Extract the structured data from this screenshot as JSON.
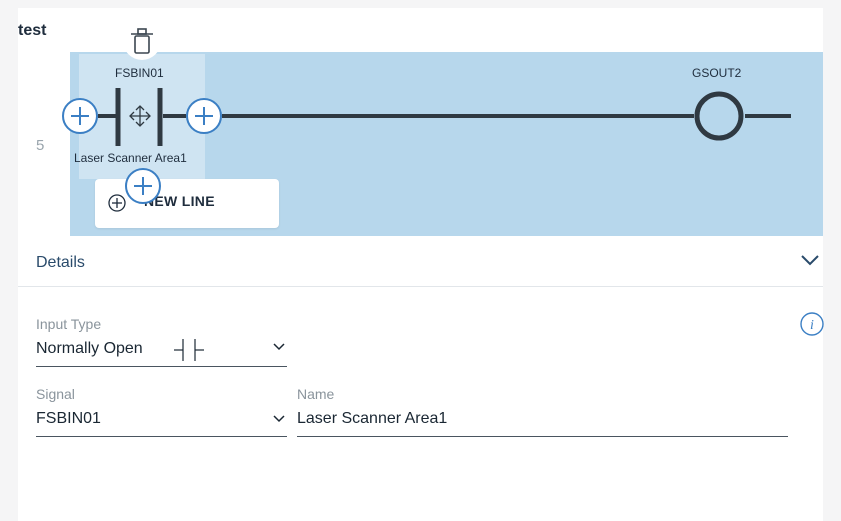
{
  "editor": {
    "program_name": "test",
    "rung_number": "5",
    "contact": {
      "signal": "FSBIN01",
      "name": "Laser Scanner Area1"
    },
    "coil": {
      "signal": "GSOUT2"
    },
    "new_line_label": "NEW LINE"
  },
  "details": {
    "title": "Details",
    "input_type_label": "Input Type",
    "input_type_value": "Normally Open",
    "signal_label": "Signal",
    "signal_value": "FSBIN01",
    "name_label": "Name",
    "name_value": "Laser Scanner Area1"
  },
  "icons": {
    "delete": "trash-icon",
    "move": "move-icon",
    "add": "plus-circle-icon",
    "collapse": "chevron-down-icon",
    "info": "info-icon",
    "dropdown": "chevron-down-icon",
    "contact_symbol": "normally-open-contact-icon"
  },
  "colors": {
    "rung_background": "#b7d7ec",
    "rung_line": "#2f3942",
    "accent": "#3b7fc4",
    "text_dark": "#1f2d3d"
  }
}
